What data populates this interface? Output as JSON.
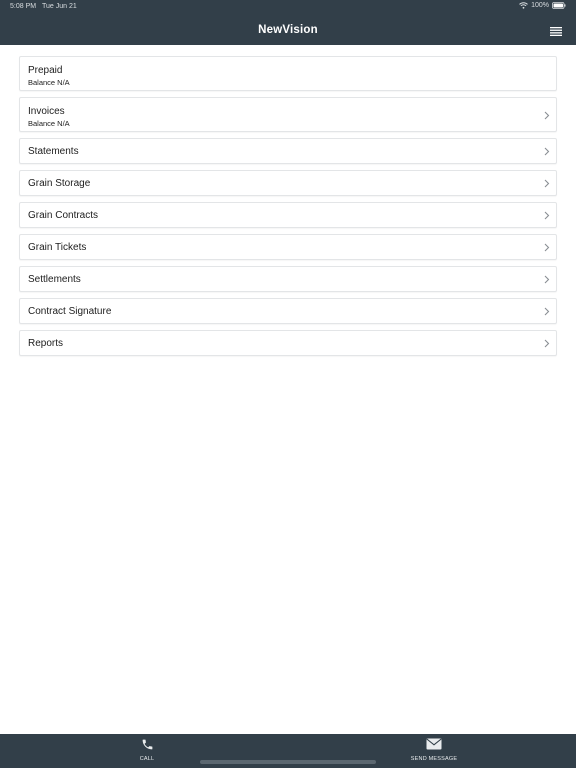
{
  "status_bar": {
    "time": "5:08 PM",
    "date": "Tue Jun 21",
    "battery": "100%"
  },
  "header": {
    "title": "NewVision",
    "menu_icon": "hamburger-menu-icon"
  },
  "colors": {
    "bar_background": "#323f49",
    "row_border": "#e3e5e7",
    "text": "#1d1d1d",
    "chevron": "#8a8f94"
  },
  "list": {
    "items": [
      {
        "label": "Prepaid",
        "sub": "Balance N/A"
      },
      {
        "label": "Invoices",
        "sub": "Balance N/A"
      },
      {
        "label": "Statements"
      },
      {
        "label": "Grain Storage"
      },
      {
        "label": "Grain Contracts"
      },
      {
        "label": "Grain Tickets"
      },
      {
        "label": "Settlements"
      },
      {
        "label": "Contract Signature"
      },
      {
        "label": "Reports"
      }
    ]
  },
  "bottom_bar": {
    "call_label": "CALL",
    "call_icon": "phone-icon",
    "message_label": "SEND MESSAGE",
    "message_icon": "envelope-icon"
  }
}
